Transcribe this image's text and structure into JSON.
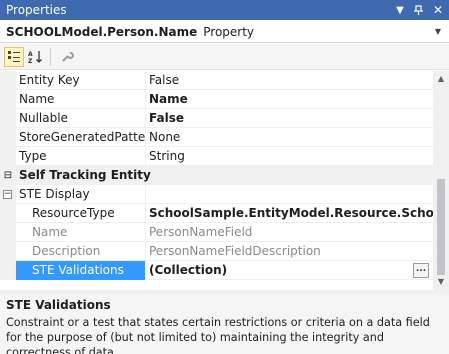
{
  "window": {
    "title": "Properties",
    "dropdown_icon": "chevron-down-icon",
    "pin_icon": "pin-icon",
    "close_icon": "close-icon"
  },
  "object_selector": {
    "name": "SCHOOLModel.Person.Name",
    "type": "Property"
  },
  "toolbar": {
    "categorized_icon": "categorized-icon",
    "alphabetical_icon": "alphabetical-icon",
    "property_pages_icon": "wrench-icon"
  },
  "grid": {
    "rows": [
      {
        "name": "Entity Key",
        "value": "False"
      },
      {
        "name": "Name",
        "value": "Name"
      },
      {
        "name": "Nullable",
        "value": "False"
      },
      {
        "name": "StoreGeneratedPattern",
        "value": "None"
      },
      {
        "name": "Type",
        "value": "String"
      }
    ],
    "category": {
      "label": "Self Tracking Entity",
      "expander": "⊟"
    },
    "ste_display": {
      "name": "STE Display",
      "expander": "⊟"
    },
    "sub_rows": [
      {
        "name": "ResourceType",
        "value": "SchoolSample.EntityModel.Resource.SchoolModelResource"
      },
      {
        "name": "Name",
        "value": "PersonNameField"
      },
      {
        "name": "Description",
        "value": "PersonNameFieldDescription"
      }
    ],
    "selected": {
      "name": "STE Validations",
      "value": "(Collection)",
      "button": "..."
    }
  },
  "description": {
    "title": "STE Validations",
    "text": "Constraint or a test that states certain restrictions or criteria on a data field for the purpose of (but not limited to) maintaining the integrity and correctness of data"
  }
}
